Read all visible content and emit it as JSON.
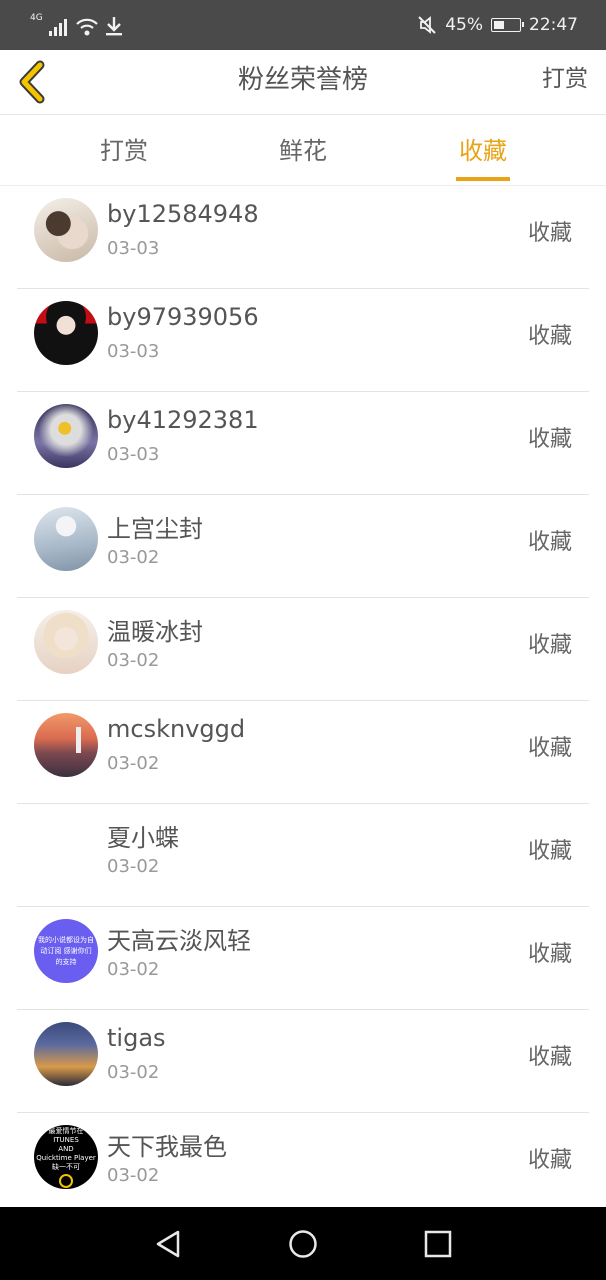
{
  "status_bar": {
    "network": "4G",
    "battery_percent": "45%",
    "battery_level": 0.45,
    "time": "22:47"
  },
  "header": {
    "title": "粉丝荣誉榜",
    "right_action": "打赏"
  },
  "tabs": [
    {
      "label": "打赏",
      "active": false
    },
    {
      "label": "鲜花",
      "active": false
    },
    {
      "label": "收藏",
      "active": true
    }
  ],
  "accent_color": "#e8a317",
  "fans": [
    {
      "name": "by12584948",
      "date": "03-03",
      "action": "收藏"
    },
    {
      "name": "by97939056",
      "date": "03-03",
      "action": "收藏"
    },
    {
      "name": "by41292381",
      "date": "03-03",
      "action": "收藏"
    },
    {
      "name": "上宫尘封",
      "date": "03-02",
      "action": "收藏"
    },
    {
      "name": "温暖冰封",
      "date": "03-02",
      "action": "收藏"
    },
    {
      "name": "mcsknvggd",
      "date": "03-02",
      "action": "收藏"
    },
    {
      "name": "夏小蝶",
      "date": "03-02",
      "action": "收藏"
    },
    {
      "name": "天高云淡风轻",
      "date": "03-02",
      "action": "收藏"
    },
    {
      "name": "tigas",
      "date": "03-02",
      "action": "收藏"
    },
    {
      "name": "天下我最色",
      "date": "03-02",
      "action": "收藏"
    }
  ],
  "avatar_texts": {
    "purple": "我的小说都设为自动订阅 感谢你们的支持",
    "black_line1": "最爱情节在",
    "black_line2": "ITUNES",
    "black_line3": "AND",
    "black_line4": "Quicktime Player",
    "black_line5": "缺一不可"
  },
  "icons": {
    "back": "chevron-left-icon",
    "nav_back": "triangle-back-icon",
    "nav_home": "circle-home-icon",
    "nav_recents": "square-recents-icon"
  }
}
